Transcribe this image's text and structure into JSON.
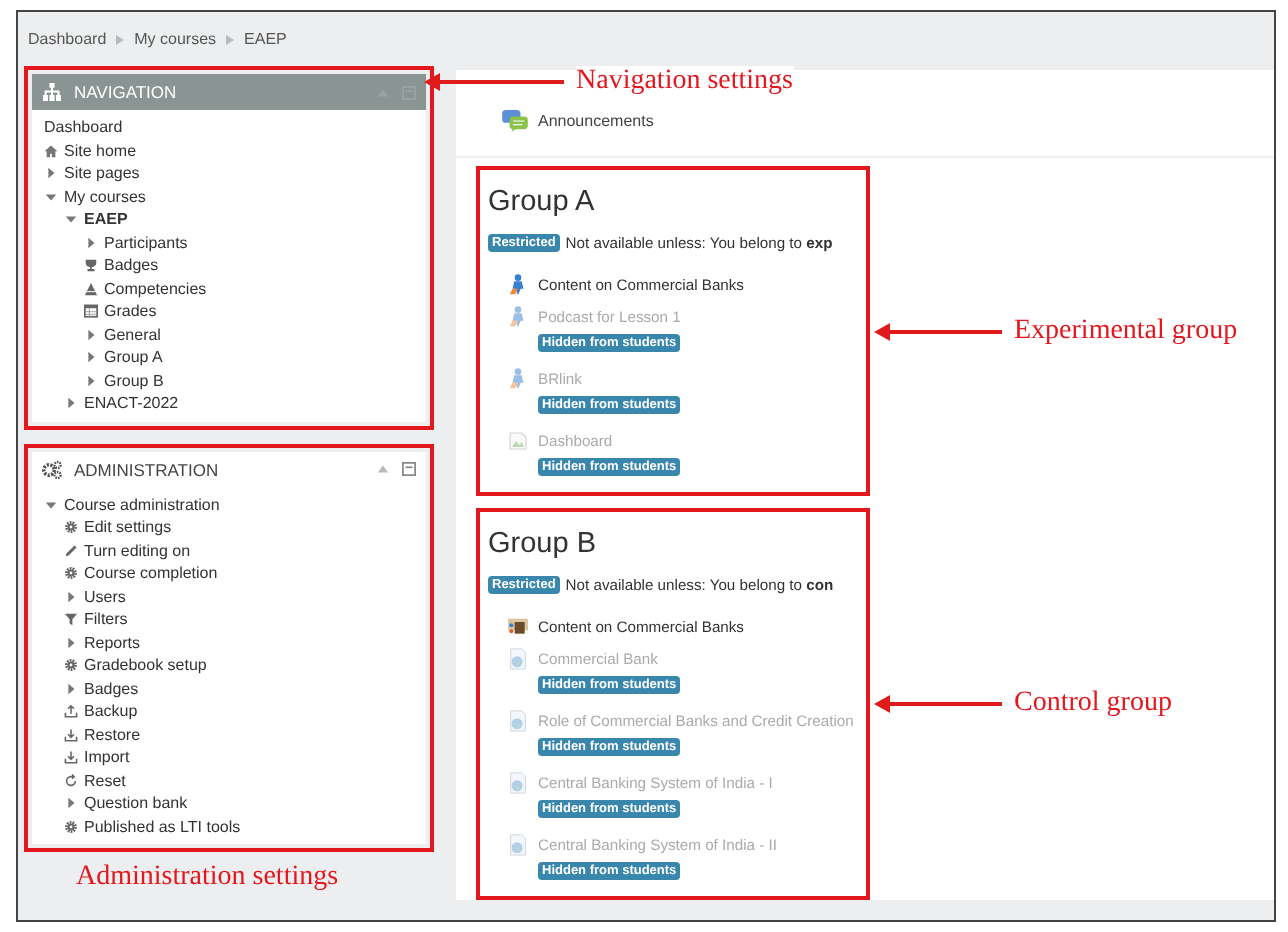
{
  "breadcrumb": [
    "Dashboard",
    "My courses",
    "EAEP"
  ],
  "navigation": {
    "title": "NAVIGATION",
    "annotation": "Navigation settings",
    "items": [
      {
        "label": "Dashboard",
        "kind": "plain"
      },
      {
        "label": "Site home",
        "kind": "home"
      },
      {
        "label": "Site pages",
        "kind": "branch",
        "expanded": false
      },
      {
        "label": "My courses",
        "kind": "branch",
        "expanded": true,
        "children": [
          {
            "label": "EAEP",
            "kind": "branch",
            "expanded": true,
            "active": true,
            "children": [
              {
                "label": "Participants",
                "kind": "branch",
                "expanded": false
              },
              {
                "label": "Badges",
                "kind": "trophy"
              },
              {
                "label": "Competencies",
                "kind": "competency"
              },
              {
                "label": "Grades",
                "kind": "grades"
              },
              {
                "label": "General",
                "kind": "branch",
                "expanded": false
              },
              {
                "label": "Group A",
                "kind": "branch",
                "expanded": false
              },
              {
                "label": "Group B",
                "kind": "branch",
                "expanded": false
              }
            ]
          },
          {
            "label": "ENACT-2022",
            "kind": "branch",
            "expanded": false
          }
        ]
      }
    ]
  },
  "administration": {
    "title": "ADMINISTRATION",
    "annotation": "Administration settings",
    "items": [
      {
        "label": "Course administration",
        "kind": "branch",
        "expanded": true,
        "children": [
          {
            "label": "Edit settings",
            "kind": "gear"
          },
          {
            "label": "Turn editing on",
            "kind": "pencil"
          },
          {
            "label": "Course completion",
            "kind": "gear"
          },
          {
            "label": "Users",
            "kind": "branch",
            "expanded": false
          },
          {
            "label": "Filters",
            "kind": "filter"
          },
          {
            "label": "Reports",
            "kind": "branch",
            "expanded": false
          },
          {
            "label": "Gradebook setup",
            "kind": "gear"
          },
          {
            "label": "Badges",
            "kind": "branch",
            "expanded": false
          },
          {
            "label": "Backup",
            "kind": "upload"
          },
          {
            "label": "Restore",
            "kind": "download"
          },
          {
            "label": "Import",
            "kind": "download"
          },
          {
            "label": "Reset",
            "kind": "reset"
          },
          {
            "label": "Question bank",
            "kind": "branch",
            "expanded": false
          },
          {
            "label": "Published as LTI tools",
            "kind": "gear"
          }
        ]
      }
    ]
  },
  "announcements": {
    "label": "Announcements"
  },
  "sections": [
    {
      "title": "Group A",
      "annotation": "Experimental group",
      "restriction": {
        "badge": "Restricted",
        "text": "Not available unless: You belong to **exp**"
      },
      "activities": [
        {
          "label": "Content on Commercial Banks",
          "kind": "lti",
          "hidden": false
        },
        {
          "label": "Podcast for Lesson 1",
          "kind": "lti",
          "hidden": true,
          "badge": "Hidden from students"
        },
        {
          "label": "BRlink",
          "kind": "lti",
          "hidden": true,
          "badge": "Hidden from students"
        },
        {
          "label": "Dashboard",
          "kind": "image",
          "hidden": true,
          "badge": "Hidden from students"
        }
      ]
    },
    {
      "title": "Group B",
      "annotation": "Control group",
      "restriction": {
        "badge": "Restricted",
        "text": "Not available unless: You belong to **con**"
      },
      "activities": [
        {
          "label": "Content on Commercial Banks",
          "kind": "book",
          "hidden": false
        },
        {
          "label": "Commercial Bank",
          "kind": "url",
          "hidden": true,
          "badge": "Hidden from students"
        },
        {
          "label": "Role of Commercial Banks and Credit Creation",
          "kind": "url",
          "hidden": true,
          "badge": "Hidden from students"
        },
        {
          "label": "Central Banking System of India - I",
          "kind": "url",
          "hidden": true,
          "badge": "Hidden from students"
        },
        {
          "label": "Central Banking System of India - II",
          "kind": "url",
          "hidden": true,
          "badge": "Hidden from students"
        }
      ]
    }
  ]
}
